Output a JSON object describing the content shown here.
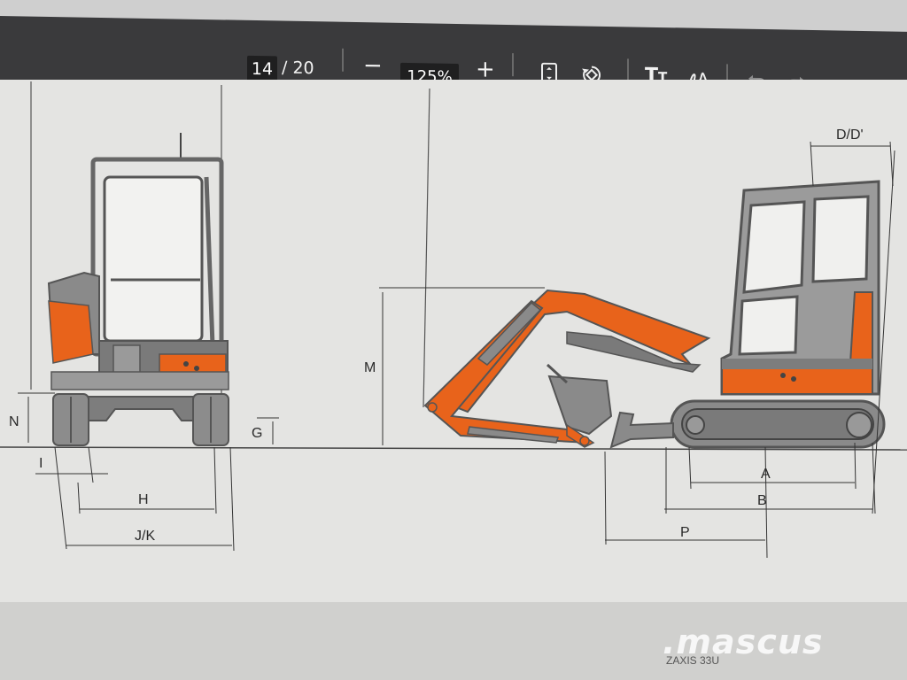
{
  "toolbar": {
    "current_page": "14",
    "total_pages": "/ 20",
    "zoom_out_label": "−",
    "zoom_level": "125%",
    "zoom_in_label": "+"
  },
  "drawing": {
    "labels": {
      "N": "N",
      "I": "I",
      "H": "H",
      "JK": "J/K",
      "G": "G",
      "M": "M",
      "D": "D/D'",
      "A": "A",
      "B": "B",
      "P": "P"
    },
    "watermark": ".mascus",
    "model_label": "ZAXIS 33U"
  },
  "colors": {
    "toolbar_bg": "#3a3a3c",
    "machine_orange": "#e8631b",
    "machine_grey": "#6e6e6e"
  }
}
